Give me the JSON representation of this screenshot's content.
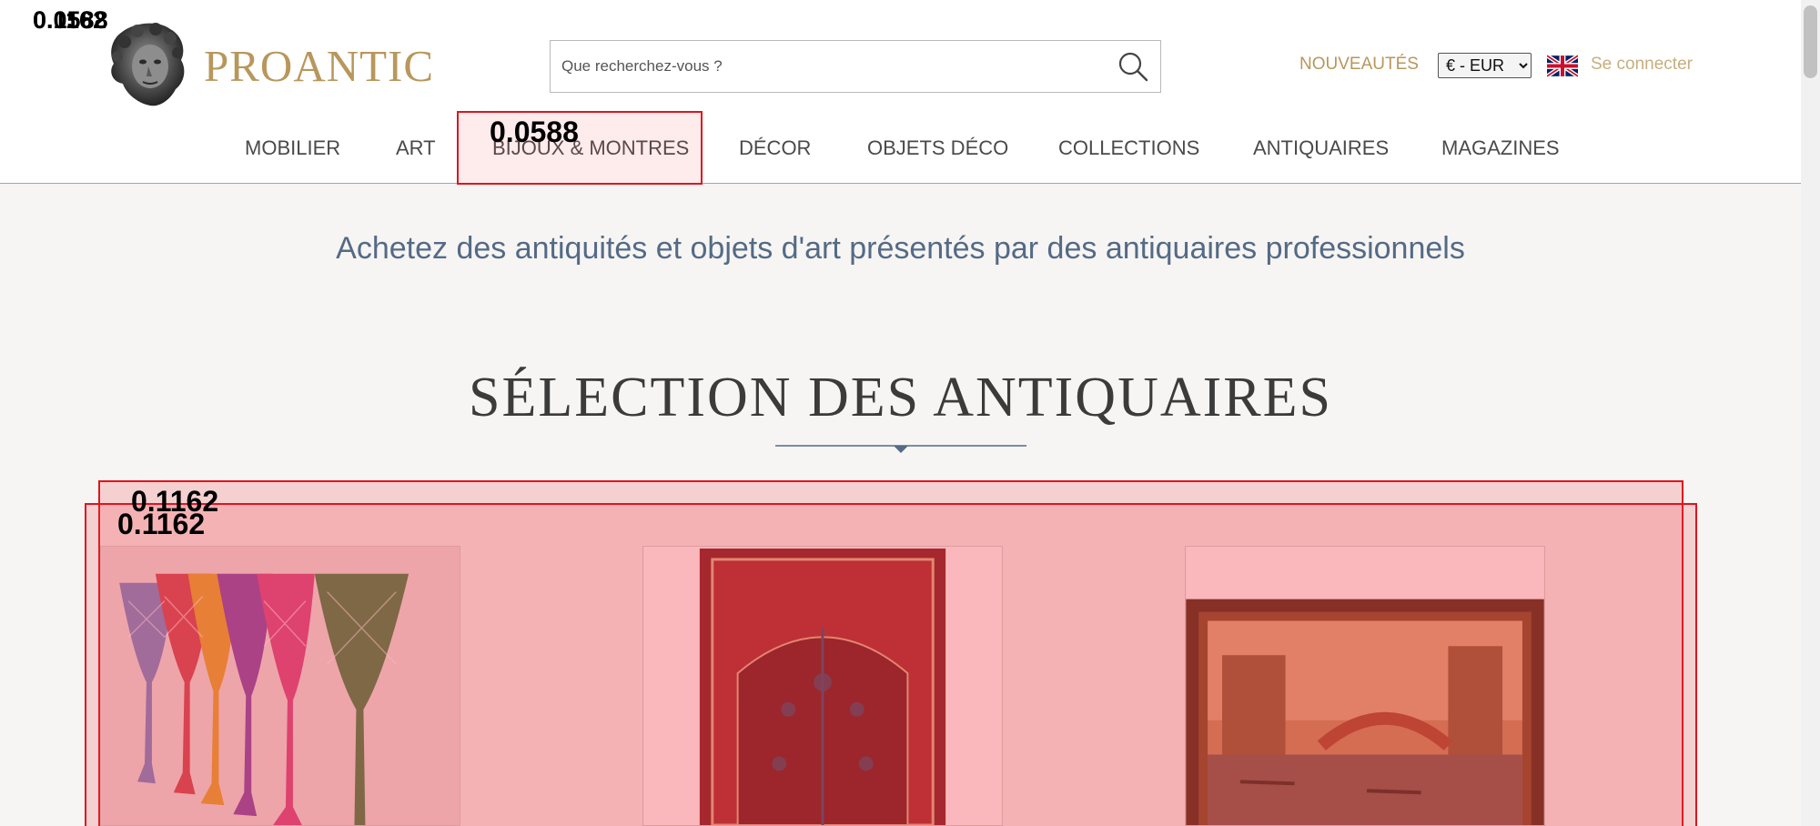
{
  "brand": {
    "name": "PROANTIC",
    "color": "#b8975c"
  },
  "search": {
    "placeholder": "Que recherchez-vous ?"
  },
  "header_links": {
    "nouveautes": "NOUVEAUTÉS",
    "login": "Se connecter"
  },
  "currency": {
    "selected": "€ - EUR"
  },
  "nav": {
    "items": [
      "MOBILIER",
      "ART",
      "BIJOUX & MONTRES",
      "DÉCOR",
      "OBJETS DÉCO",
      "COLLECTIONS",
      "ANTIQUAIRES",
      "MAGAZINES"
    ]
  },
  "intro": "Achetez des antiquités et objets d'art présentés par des antiquaires professionnels",
  "selection_title": "SÉLECTION DES ANTIQUAIRES",
  "overlays": {
    "logo_label": "0.0588",
    "logo_label_ghost": "0.1162",
    "nav_label": "0.0588",
    "section_label_1": "0.1162",
    "section_label_2": "0.1162"
  },
  "colors": {
    "accent": "#b8975c",
    "intro_text": "#546a86",
    "overlay": "#e0141e"
  },
  "icons": {
    "search": "search-icon",
    "flag": "uk-flag-icon",
    "logo": "bust-logo-icon"
  }
}
